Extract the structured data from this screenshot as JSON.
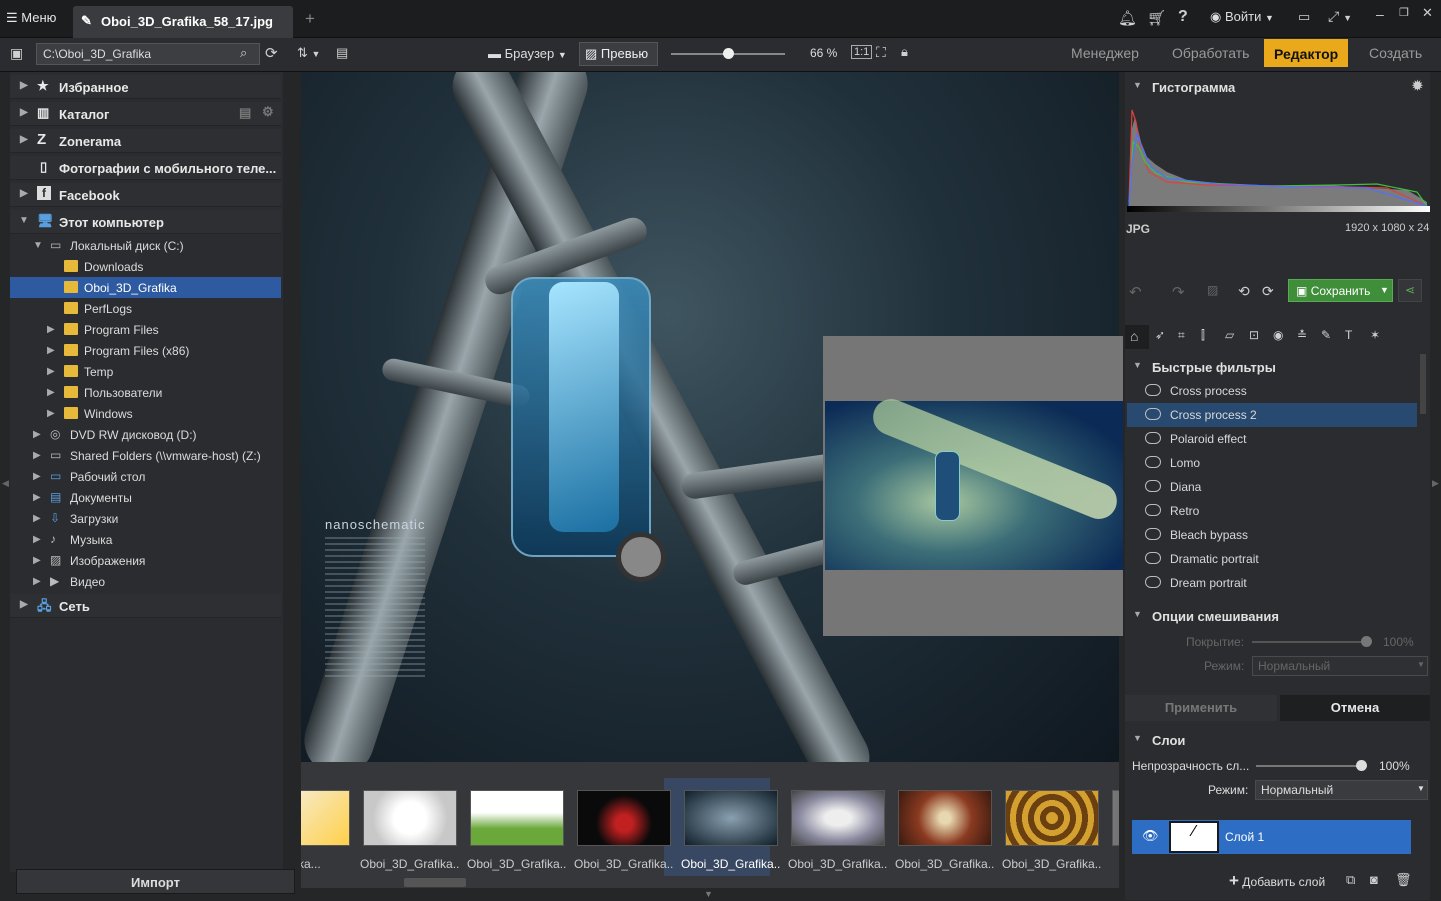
{
  "topbar": {
    "menu_label": "Меню",
    "tab_title": "Oboi_3D_Grafika_58_17.jpg",
    "add_tab": "+",
    "login_label": "Войти"
  },
  "toolbar": {
    "path": "C:\\Oboi_3D_Grafika",
    "browser_label": "Браузер",
    "preview_label": "Превью",
    "zoom": "66 %",
    "zoom_level": 0.5,
    "modes": [
      "Менеджер",
      "Обработать",
      "Редактор",
      "Создать"
    ],
    "active_mode": "Редактор"
  },
  "sidebar": {
    "top_items": [
      "Избранное",
      "Каталог",
      "Zonerama",
      "Фотографии с мобильного теле...",
      "Facebook",
      "Этот компьютер"
    ],
    "tree": [
      {
        "label": "Локальный диск (C:)"
      },
      {
        "label": "Downloads"
      },
      {
        "label": "Oboi_3D_Grafika"
      },
      {
        "label": "PerfLogs"
      },
      {
        "label": "Program Files"
      },
      {
        "label": "Program Files (x86)"
      },
      {
        "label": "Temp"
      },
      {
        "label": "Пользователи"
      },
      {
        "label": "Windows"
      },
      {
        "label": "DVD RW дисковод (D:)"
      },
      {
        "label": "Shared Folders (\\\\vmware-host) (Z:)"
      },
      {
        "label": "Рабочий стол"
      },
      {
        "label": "Документы"
      },
      {
        "label": "Загрузки"
      },
      {
        "label": "Музыка"
      },
      {
        "label": "Изображения"
      },
      {
        "label": "Видео"
      }
    ],
    "network": "Сеть",
    "import_label": "Импорт"
  },
  "filmstrip": {
    "captions": [
      "afika...",
      "Oboi_3D_Grafika...",
      "Oboi_3D_Grafika...",
      "Oboi_3D_Grafika...",
      "Oboi_3D_Grafika...",
      "Oboi_3D_Grafika...",
      "Oboi_3D_Grafika...",
      "Oboi_3D_Grafika...",
      "Obo"
    ]
  },
  "image_overlay": {
    "brand_text": "nanoschematic"
  },
  "right": {
    "histogram_title": "Гистограмма",
    "format": "JPG",
    "dimensions": "1920 x 1080 x 24",
    "save_label": "Сохранить",
    "quick_filters_title": "Быстрые фильтры",
    "filters": [
      "Cross process",
      "Cross process 2",
      "Polaroid effect",
      "Lomo",
      "Diana",
      "Retro",
      "Bleach bypass",
      "Dramatic portrait",
      "Dream portrait"
    ],
    "blend_title": "Опции смешивания",
    "coverage_label": "Покрытие:",
    "coverage_value": "100%",
    "mode_label": "Режим:",
    "mode_value": "Нормальный",
    "apply_label": "Применить",
    "cancel_label": "Отмена",
    "layers_title": "Слои",
    "layer_opacity_label": "Непрозрачность сл...",
    "layer_opacity_value": "100%",
    "layer_mode_label": "Режим:",
    "layer_mode_value": "Нормальный",
    "layer_name": "Слой 1",
    "add_layer_label": "Добавить слой"
  },
  "colors": {
    "accent": "#e9a91a",
    "selection": "#2d5aa0",
    "layer_selected": "#2d6ec4",
    "save_button": "#3f8f3a"
  }
}
